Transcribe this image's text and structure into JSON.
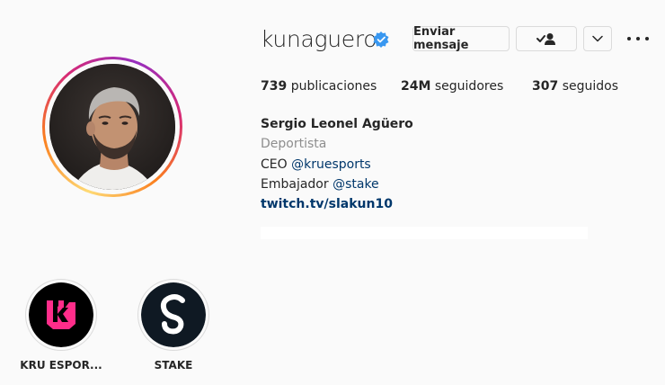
{
  "profile": {
    "username": "kunaguero",
    "verified_icon": "verified-badge-icon",
    "buttons": {
      "message": "Enviar mensaje",
      "follow_icon": "following-check-icon",
      "dropdown_icon": "chevron-down-icon",
      "more_icon": "more-options-icon"
    },
    "stats": {
      "posts_count": "739",
      "posts_label": "publicaciones",
      "followers_count": "24M",
      "followers_label": "seguidores",
      "following_count": "307",
      "following_label": "seguidos"
    },
    "bio": {
      "full_name": "Sergio Leonel Agüero",
      "category": "Deportista",
      "line1_prefix": "CEO ",
      "line1_mention": "@kruesports",
      "line2_prefix": "Embajador ",
      "line2_mention": "@stake",
      "link": "twitch.tv/slakun10"
    }
  },
  "highlights": [
    {
      "label": "KRU ESPOR...",
      "icon": "kru-logo-icon",
      "bg": "#000000",
      "accent": "#ff2d8a"
    },
    {
      "label": "STAKE",
      "icon": "stake-logo-icon",
      "bg": "#0f1923",
      "accent": "#ffffff"
    }
  ],
  "colors": {
    "link": "#00376b",
    "verified": "#3897f0",
    "secondary_text": "#8e8e8e"
  }
}
